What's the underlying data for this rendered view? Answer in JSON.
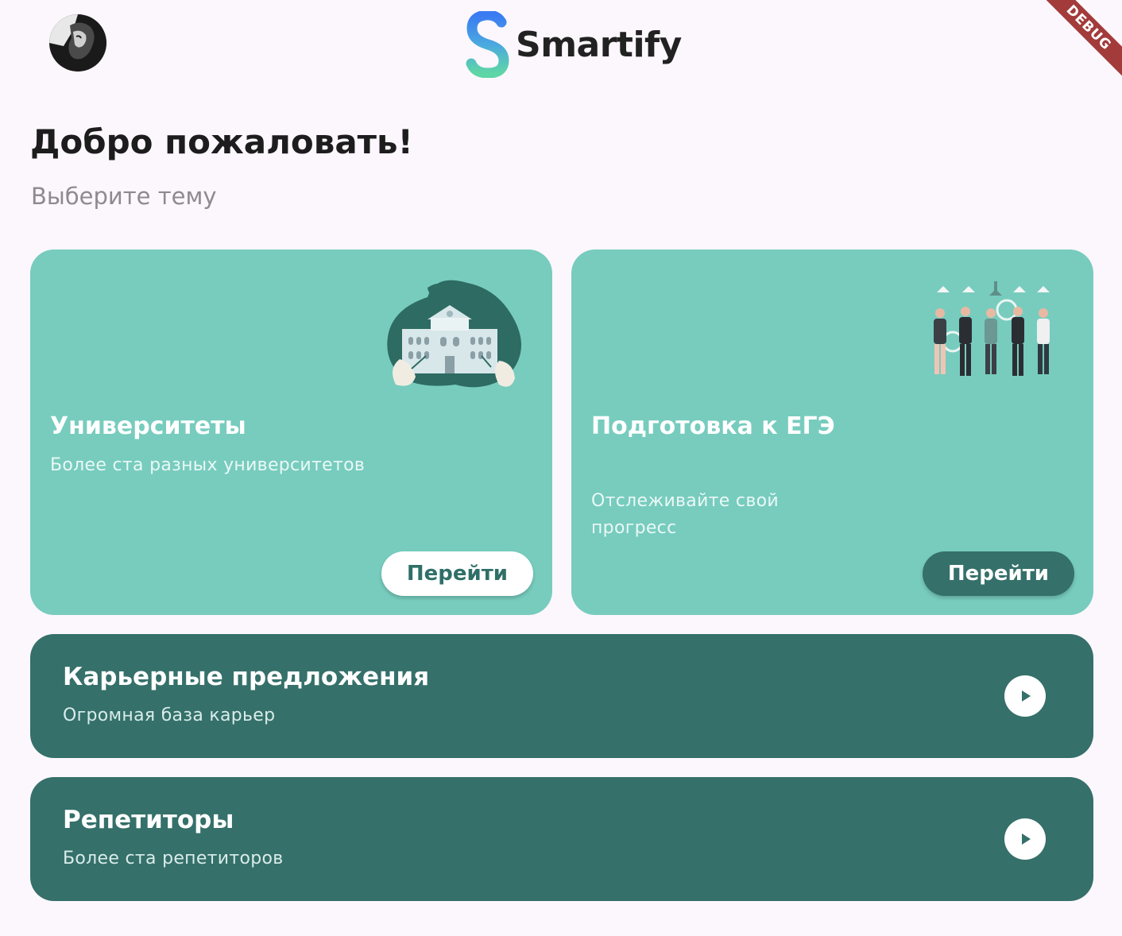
{
  "app": {
    "brand": "Smartify",
    "debug_label": "DEBUG"
  },
  "header": {
    "welcome": "Добро пожаловать!",
    "subtitle": "Выберите тему"
  },
  "cards": [
    {
      "title": "Университеты",
      "description": "Более ста разных университетов",
      "button_label": "Перейти",
      "illustration": "university-building-illustration"
    },
    {
      "title": "Подготовка к ЕГЭ",
      "description": "Отслеживайте свой прогресс",
      "button_label": "Перейти",
      "illustration": "people-group-illustration"
    }
  ],
  "banners": [
    {
      "title": "Карьерные предложения",
      "description": "Огромная база карьер",
      "icon": "play-icon"
    },
    {
      "title": "Репетиторы",
      "description": "Более ста репетиторов",
      "icon": "play-icon"
    }
  ],
  "colors": {
    "background": "#fcf7fc",
    "card_light": "#77ccbe",
    "card_dark": "#35706a",
    "debug_ribbon": "#a33b3b"
  }
}
